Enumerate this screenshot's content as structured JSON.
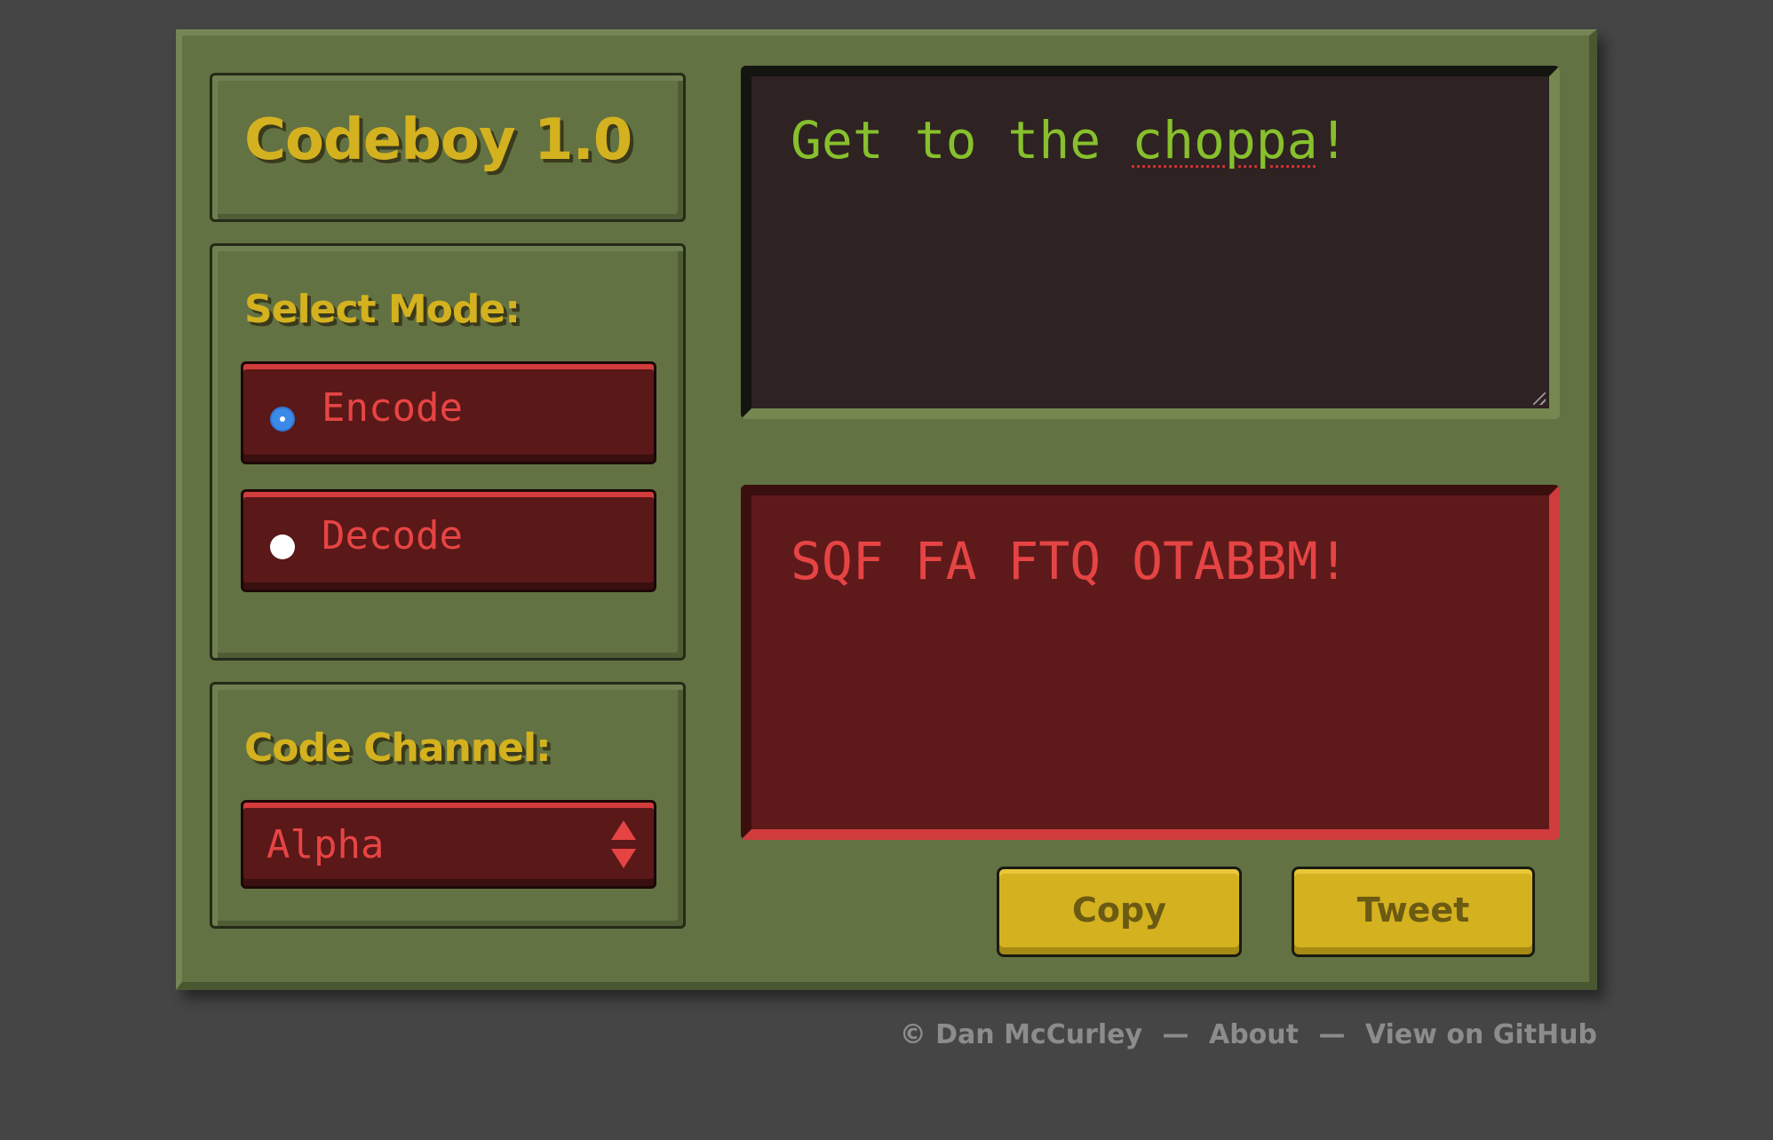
{
  "app": {
    "title": "Codeboy 1.0"
  },
  "mode": {
    "heading": "Select Mode:",
    "options": [
      {
        "label": "Encode",
        "checked": true
      },
      {
        "label": "Decode",
        "checked": false
      }
    ]
  },
  "channel": {
    "heading": "Code Channel:",
    "selected": "Alpha"
  },
  "input": {
    "text_before": "Get to the ",
    "misspelled_word": "choppa",
    "text_after": "!"
  },
  "output": {
    "text": "SQF FA FTQ OTABBM!"
  },
  "actions": {
    "copy_label": "Copy",
    "tweet_label": "Tweet"
  },
  "footer": {
    "copyright": "© Dan McCurley",
    "separator": "—",
    "about": "About",
    "github": "View on GitHub"
  },
  "colors": {
    "background": "#454545",
    "device": "#627243",
    "accent_yellow": "#d4b11f",
    "input_text_green": "#87c02c",
    "output_red": "#e64444",
    "radio_checked": "#3b8ae8"
  }
}
